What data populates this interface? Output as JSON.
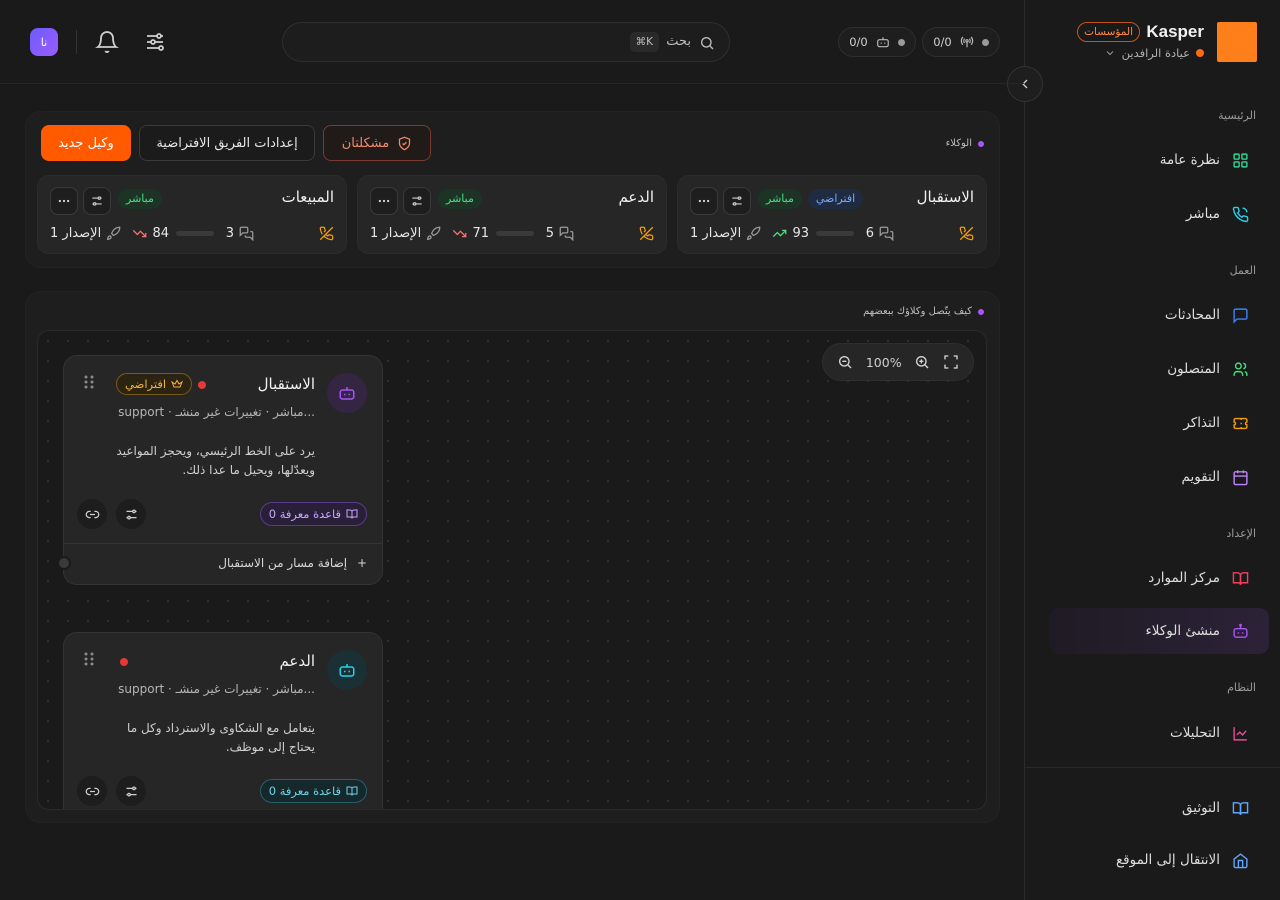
{
  "brand": {
    "name": "Kasper",
    "badge": "المؤسسات",
    "org": "عيادة الرافدين"
  },
  "topbar": {
    "search_placeholder": "بحث",
    "search_kbd": "⌘K",
    "stat_calls": "0/0",
    "stat_bots": "0/0",
    "avatar_initials": "نا"
  },
  "sidebar": {
    "sections": {
      "main": "الرئيسية",
      "work": "العمل",
      "setup": "الإعداد",
      "system": "النظام"
    },
    "items": {
      "overview": "نظرة عامة",
      "live": "مباشر",
      "conversations": "المحادثات",
      "contacts": "المتصلون",
      "tickets": "التذاكر",
      "calendar": "التقويم",
      "resources": "مركز الموارد",
      "agent_builder": "منشئ الوكلاء",
      "analytics": "التحليلات",
      "docs": "التوثيق",
      "goto_site": "الانتقال إلى الموقع"
    }
  },
  "agents_panel": {
    "label": "الوكلاء",
    "new_agent": "وكيل جديد",
    "team_defaults": "إعدادات الفريق الافتراضية",
    "issues": "مشكلتان"
  },
  "agents": [
    {
      "name": "الاستقبال",
      "default_badge": "افتراضي",
      "live_badge": "مباشر",
      "conversations": "6",
      "score": "93",
      "score_pct": 100,
      "trend": "up",
      "version": "الإصدار 1",
      "bar_color": "#4ade80"
    },
    {
      "name": "الدعم",
      "live_badge": "مباشر",
      "conversations": "5",
      "score": "71",
      "score_pct": 100,
      "trend": "down",
      "version": "الإصدار 1",
      "bar_color": "#60a5fa"
    },
    {
      "name": "المبيعات",
      "live_badge": "مباشر",
      "conversations": "3",
      "score": "84",
      "score_pct": 100,
      "trend": "down",
      "version": "الإصدار 1",
      "bar_color": "#60a5fa"
    }
  ],
  "flow": {
    "label": "كيف يتّصل وكلاؤك ببعضهم",
    "zoom": "100%",
    "nodes": [
      {
        "title": "الاستقبال",
        "default_badge": "افتراضي",
        "meta": "support · مباشر · تغييرات غير منشـ...",
        "desc": "يرد على الخط الرئيسي، ويحجز المواعيد ويعدّلها، ويحيل ما عدا ذلك.",
        "kb": "0 قاعدة معرفة",
        "add_route": "إضافة مسار من الاستقبال",
        "accent": "#a855f7"
      },
      {
        "title": "الدعم",
        "meta": "support · مباشر · تغييرات غير منشـ...",
        "desc": "يتعامل مع الشكاوى والاسترداد وكل ما يحتاج إلى موظف.",
        "kb": "0 قاعدة معرفة",
        "accent": "#22d3ee"
      }
    ]
  },
  "colors": {
    "accent": "#ff5a00",
    "brand": "#ff7f1a",
    "active_nav": "#a855f7"
  }
}
